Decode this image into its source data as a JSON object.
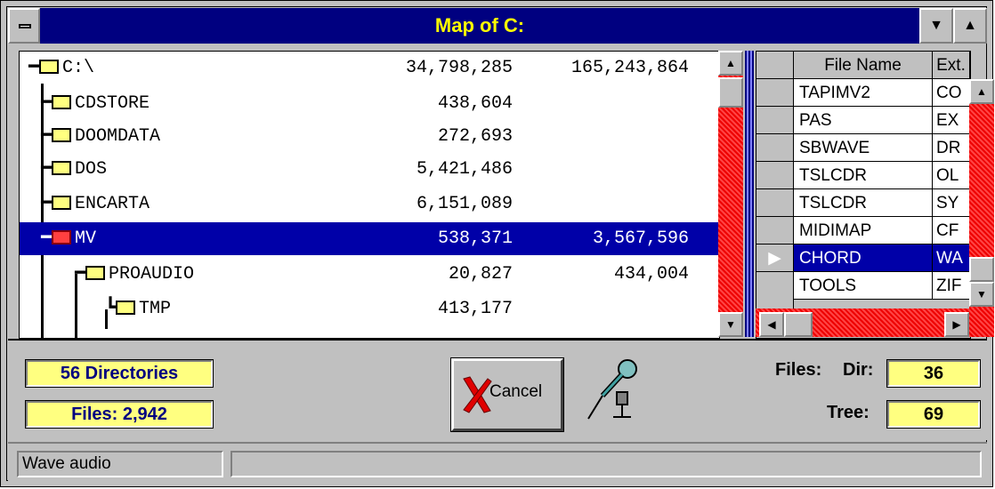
{
  "window": {
    "title": "Map of C:"
  },
  "tree": {
    "rows": [
      {
        "name": "C:\\",
        "v1": "34,798,285",
        "v2": "165,243,864"
      },
      {
        "name": "CDSTORE",
        "v1": "438,604",
        "v2": ""
      },
      {
        "name": "DOOMDATA",
        "v1": "272,693",
        "v2": ""
      },
      {
        "name": "DOS",
        "v1": "5,421,486",
        "v2": ""
      },
      {
        "name": "ENCARTA",
        "v1": "6,151,089",
        "v2": ""
      },
      {
        "name": "MV",
        "v1": "538,371",
        "v2": "3,567,596"
      },
      {
        "name": "PROAUDIO",
        "v1": "20,827",
        "v2": "434,004"
      },
      {
        "name": "TMP",
        "v1": "413,177",
        "v2": ""
      }
    ]
  },
  "grid": {
    "headers": {
      "name": "File Name",
      "ext": "Ext."
    },
    "rows": [
      {
        "name": "TAPIMV2",
        "ext": "CO"
      },
      {
        "name": "PAS",
        "ext": "EX"
      },
      {
        "name": "SBWAVE",
        "ext": "DR"
      },
      {
        "name": "TSLCDR",
        "ext": "OL"
      },
      {
        "name": "TSLCDR",
        "ext": "SY"
      },
      {
        "name": "MIDIMAP",
        "ext": "CF"
      },
      {
        "name": "CHORD",
        "ext": "WA"
      },
      {
        "name": "TOOLS",
        "ext": "ZIF"
      }
    ]
  },
  "stats": {
    "directories": "56 Directories",
    "files": "Files: 2,942",
    "files_label": "Files:",
    "dir_label": "Dir:",
    "dir_value": "36",
    "tree_label": "Tree:",
    "tree_value": "69"
  },
  "buttons": {
    "cancel": "Cancel"
  },
  "status": {
    "text": "Wave audio"
  }
}
